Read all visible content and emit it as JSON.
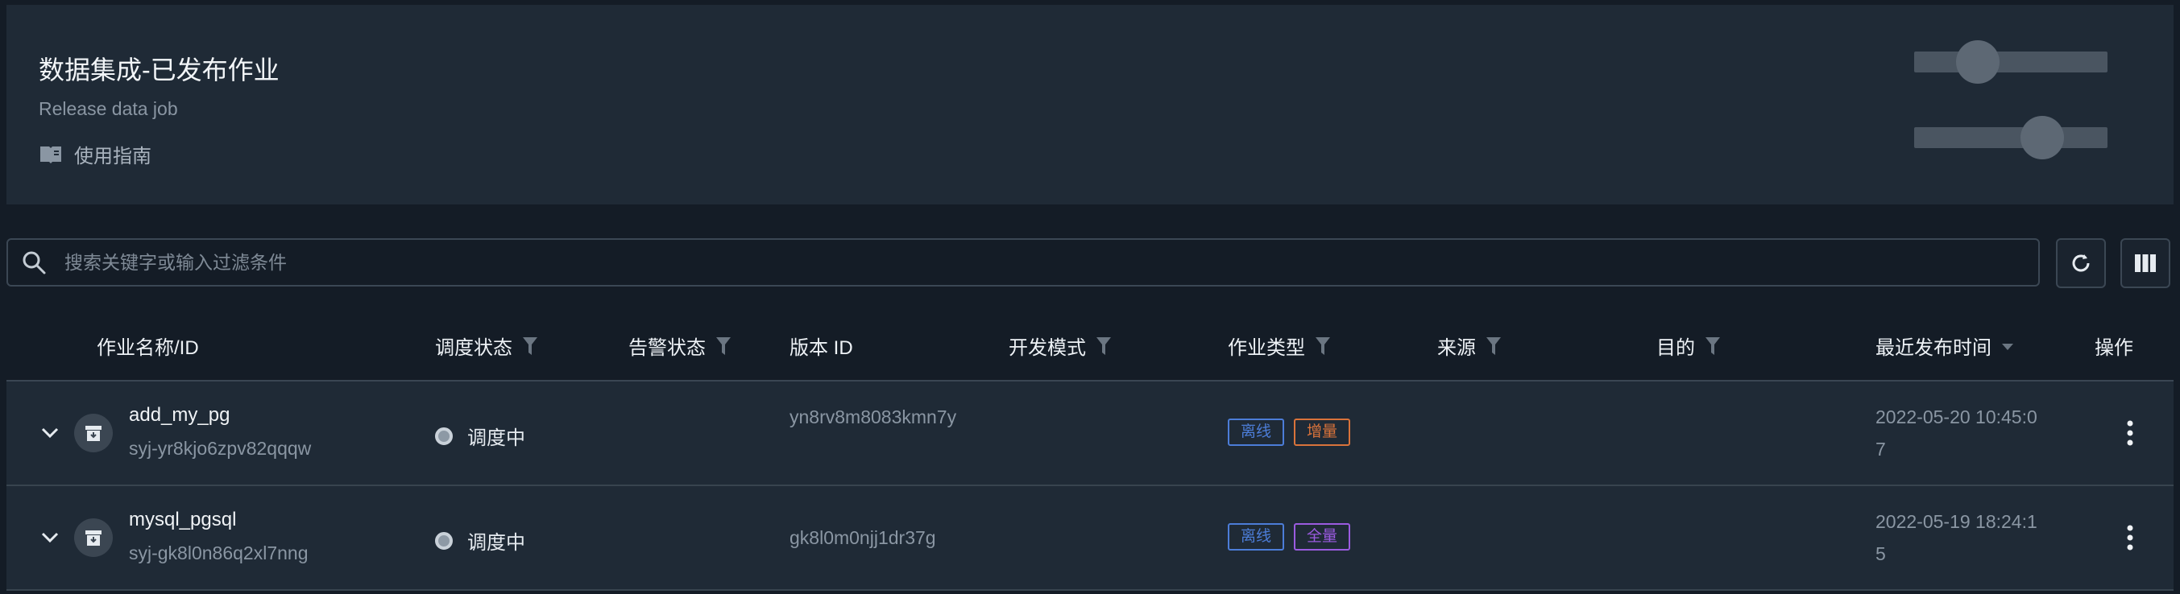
{
  "header": {
    "title": "数据集成-已发布作业",
    "subtitle": "Release data job",
    "guide_label": "使用指南"
  },
  "search": {
    "placeholder": "搜索关键字或输入过滤条件"
  },
  "table": {
    "columns": {
      "name": "作业名称/ID",
      "schedule_status": "调度状态",
      "alert_status": "告警状态",
      "version_id": "版本 ID",
      "dev_mode": "开发模式",
      "job_type": "作业类型",
      "source": "来源",
      "target": "目的",
      "last_release": "最近发布时间",
      "actions": "操作"
    },
    "rows": [
      {
        "name": "add_my_pg",
        "id": "syj-yr8kjo6zpv82qqqw",
        "schedule_status": "调度中",
        "version_id": "yn8rv8m8083kmn7y",
        "tags": [
          "离线",
          "增量"
        ],
        "last_release": "2022-05-20 10:45:07"
      },
      {
        "name": "mysql_pgsql",
        "id": "syj-gk8l0n86q2xl7nng",
        "schedule_status": "调度中",
        "version_id": "gk8l0m0njj1dr37g",
        "tags": [
          "离线",
          "全量"
        ],
        "last_release": "2022-05-19 18:24:15"
      }
    ]
  },
  "colors": {
    "tag_offline": "#4c7dd8",
    "tag_incremental": "#d9733b",
    "tag_full": "#9b5be0"
  }
}
